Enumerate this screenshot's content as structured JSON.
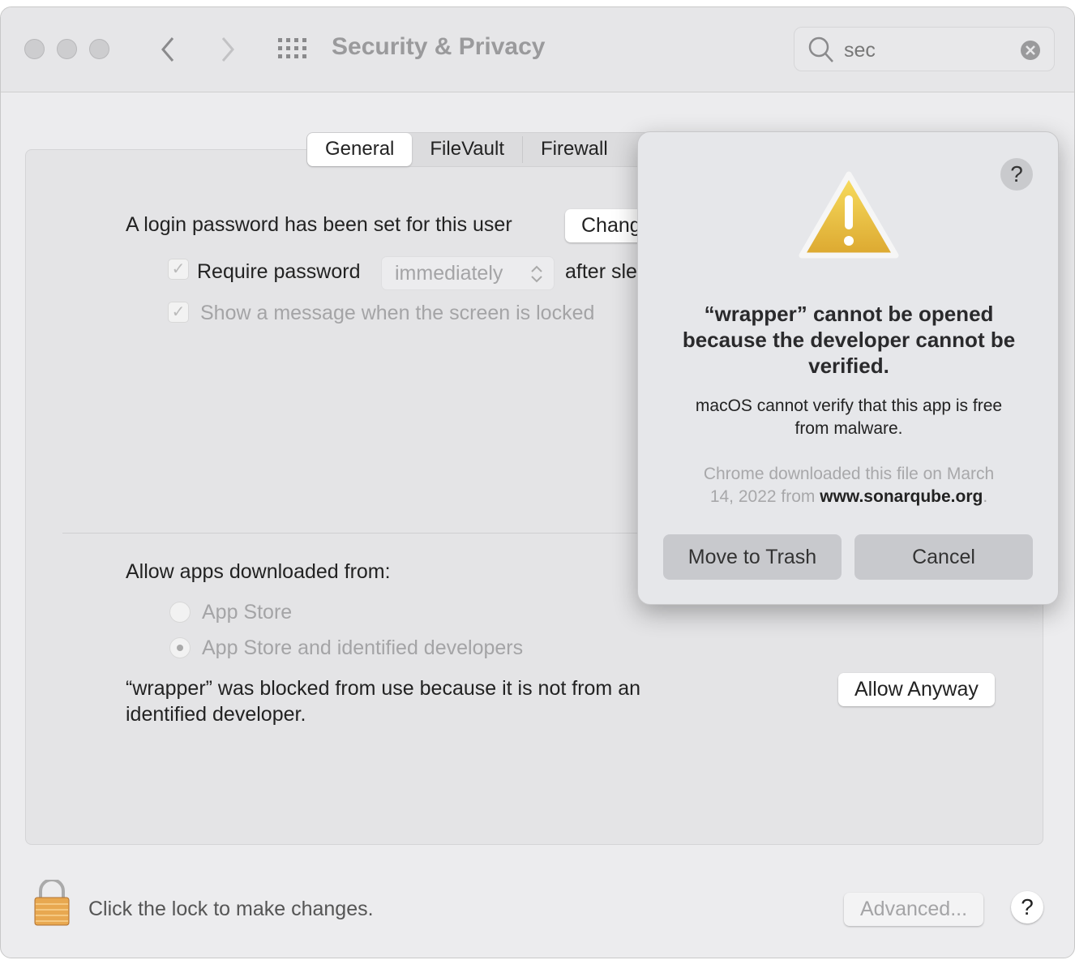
{
  "window": {
    "title": "Security & Privacy",
    "search_value": "sec"
  },
  "tabs": [
    {
      "label": "General",
      "selected": true
    },
    {
      "label": "FileVault"
    },
    {
      "label": "Firewall"
    }
  ],
  "general": {
    "login_text": "A login password has been set for this user",
    "change_button": "Chang",
    "require_password": {
      "label": "Require password",
      "checked": true,
      "select_value": "immediately",
      "suffix": "after sle"
    },
    "show_message": {
      "label": "Show a message when the screen is locked",
      "checked": true
    },
    "allow_label": "Allow apps downloaded from:",
    "radio_options": [
      {
        "label": "App Store",
        "selected": false
      },
      {
        "label": "App Store and identified developers",
        "selected": true
      }
    ],
    "blocked_text_line1": "“wrapper” was blocked from use because it is not from an",
    "blocked_text_line2": "identified developer.",
    "allow_anyway": "Allow Anyway"
  },
  "footer": {
    "lock_text": "Click the lock to make changes.",
    "advanced": "Advanced...",
    "help": "?"
  },
  "dialog": {
    "help": "?",
    "title_lines": [
      "“wrapper” cannot be opened",
      "because the developer cannot be",
      "verified."
    ],
    "message_lines": [
      "macOS cannot verify that this app is free",
      "from malware."
    ],
    "source_line1": "Chrome downloaded this file on March",
    "source_line2_prefix": "14, 2022 from ",
    "source_domain": "www.sonarqube.org",
    "source_suffix": ".",
    "buttons": {
      "trash": "Move to Trash",
      "cancel": "Cancel"
    },
    "icon": "warning-triangle-icon",
    "icon_color": "#e8b834"
  }
}
